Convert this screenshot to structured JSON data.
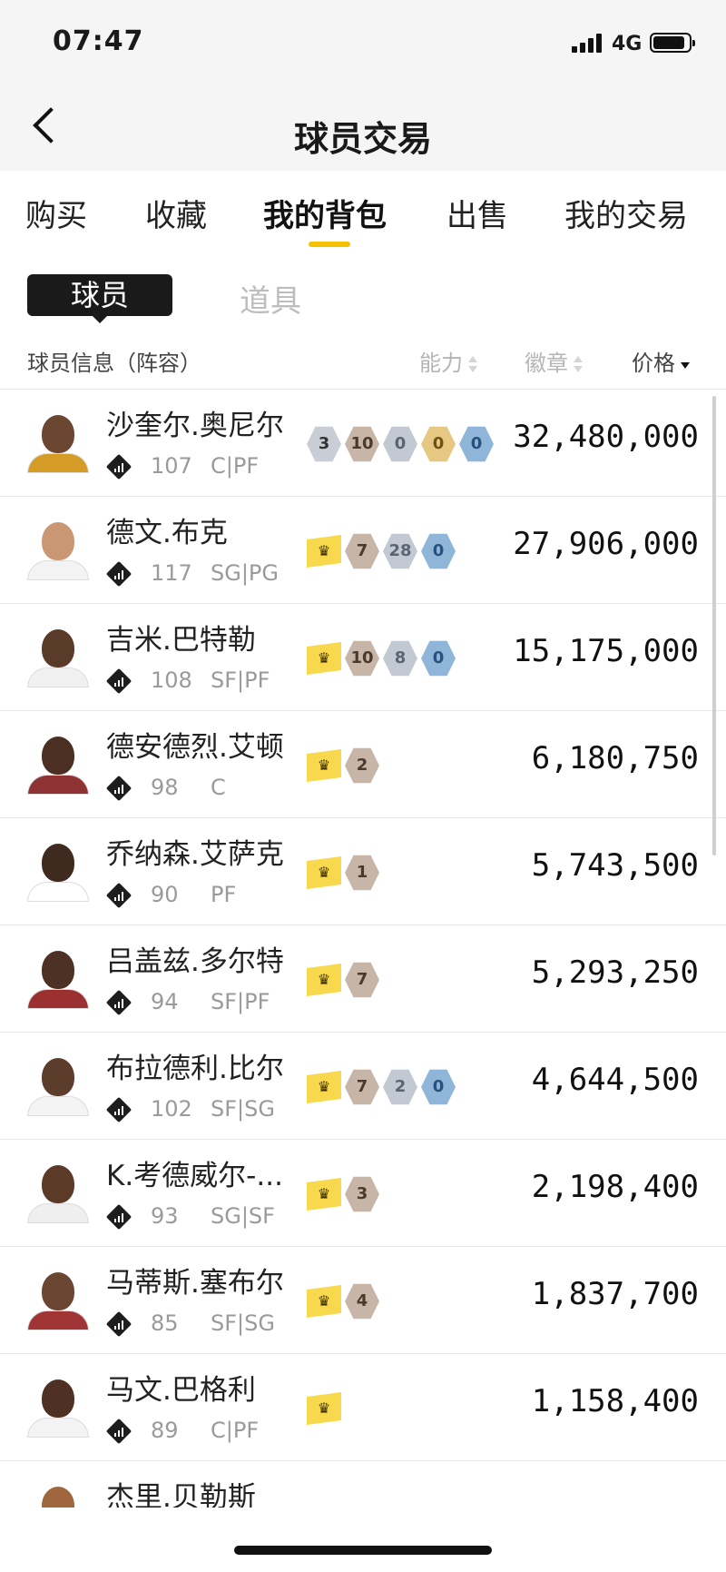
{
  "status": {
    "time": "07:47",
    "network": "4G"
  },
  "header": {
    "title": "球员交易"
  },
  "tabs": [
    {
      "label": "购买"
    },
    {
      "label": "收藏"
    },
    {
      "label": "我的背包"
    },
    {
      "label": "出售"
    },
    {
      "label": "我的交易"
    }
  ],
  "segments": {
    "players": "球员",
    "items": "道具"
  },
  "columns": {
    "info": "球员信息（阵容）",
    "ability": "能力",
    "badge": "徽章",
    "price": "价格"
  },
  "players": [
    {
      "name": "沙奎尔.奥尼尔",
      "ovr": "107",
      "pos": "C|PF",
      "price": "32,480,000",
      "badges": [
        {
          "kind": "grey",
          "text": "3"
        },
        {
          "kind": "bronze",
          "text": "10"
        },
        {
          "kind": "silver",
          "text": "0"
        },
        {
          "kind": "gold",
          "text": "0"
        },
        {
          "kind": "blue",
          "text": "0"
        }
      ]
    },
    {
      "name": "德文.布克",
      "ovr": "117",
      "pos": "SG|PG",
      "price": "27,906,000",
      "badges": [
        {
          "kind": "crown",
          "text": "♛"
        },
        {
          "kind": "bronze",
          "text": "7"
        },
        {
          "kind": "silver",
          "text": "28"
        },
        {
          "kind": "blue",
          "text": "0"
        }
      ]
    },
    {
      "name": "吉米.巴特勒",
      "ovr": "108",
      "pos": "SF|PF",
      "price": "15,175,000",
      "badges": [
        {
          "kind": "crown",
          "text": "♛"
        },
        {
          "kind": "bronze",
          "text": "10"
        },
        {
          "kind": "silver",
          "text": "8"
        },
        {
          "kind": "blue",
          "text": "0"
        }
      ]
    },
    {
      "name": "德安德烈.艾顿",
      "ovr": "98",
      "pos": "C",
      "price": "6,180,750",
      "badges": [
        {
          "kind": "crown",
          "text": "♛"
        },
        {
          "kind": "bronze",
          "text": "2"
        }
      ]
    },
    {
      "name": "乔纳森.艾萨克",
      "ovr": "90",
      "pos": "PF",
      "price": "5,743,500",
      "badges": [
        {
          "kind": "crown",
          "text": "♛"
        },
        {
          "kind": "bronze",
          "text": "1"
        }
      ]
    },
    {
      "name": "吕盖兹.多尔特",
      "ovr": "94",
      "pos": "SF|PF",
      "price": "5,293,250",
      "badges": [
        {
          "kind": "crown",
          "text": "♛"
        },
        {
          "kind": "bronze",
          "text": "7"
        }
      ]
    },
    {
      "name": "布拉德利.比尔",
      "ovr": "102",
      "pos": "SF|SG",
      "price": "4,644,500",
      "badges": [
        {
          "kind": "crown",
          "text": "♛"
        },
        {
          "kind": "bronze",
          "text": "7"
        },
        {
          "kind": "silver",
          "text": "2"
        },
        {
          "kind": "blue",
          "text": "0"
        }
      ]
    },
    {
      "name": "K.考德威尔-...",
      "ovr": "93",
      "pos": "SG|SF",
      "price": "2,198,400",
      "badges": [
        {
          "kind": "crown",
          "text": "♛"
        },
        {
          "kind": "bronze",
          "text": "3"
        }
      ]
    },
    {
      "name": "马蒂斯.塞布尔",
      "ovr": "85",
      "pos": "SF|SG",
      "price": "1,837,700",
      "badges": [
        {
          "kind": "crown",
          "text": "♛"
        },
        {
          "kind": "bronze",
          "text": "4"
        }
      ]
    },
    {
      "name": "马文.巴格利",
      "ovr": "89",
      "pos": "C|PF",
      "price": "1,158,400",
      "badges": [
        {
          "kind": "crown",
          "text": "♛"
        }
      ]
    },
    {
      "name": "杰里.贝勒斯",
      "ovr": "",
      "pos": "",
      "price": "",
      "badges": []
    }
  ],
  "colors": {
    "accent": "#f5c000",
    "crown": "#f8d84d"
  }
}
